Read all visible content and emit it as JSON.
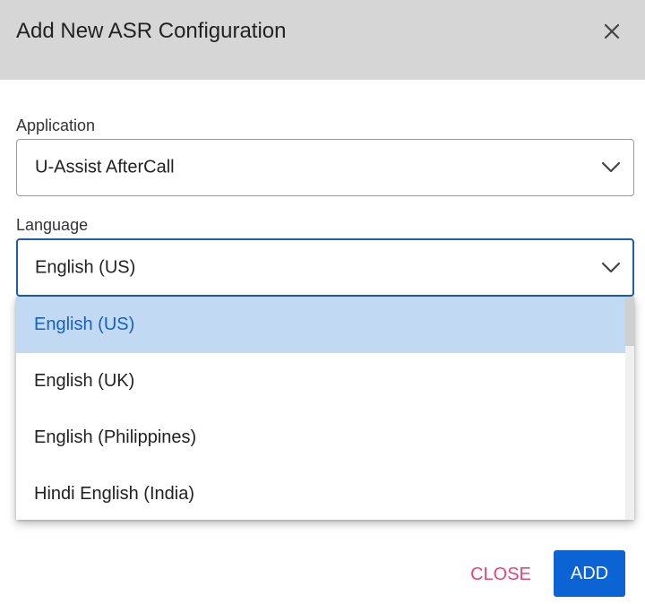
{
  "dialog": {
    "title": "Add New ASR Configuration"
  },
  "application_field": {
    "label": "Application",
    "value": "U-Assist AfterCall"
  },
  "language_field": {
    "label": "Language",
    "value": "English (US)",
    "options": [
      "English (US)",
      "English (UK)",
      "English (Philippines)",
      "Hindi English (India)"
    ],
    "selected_index": 0
  },
  "footer": {
    "close_label": "CLOSE",
    "add_label": "ADD"
  },
  "colors": {
    "header_bg": "#d6d6d6",
    "primary": "#0b63d4",
    "close_text": "#e8457a",
    "selected_option_bg": "#c2d9f3",
    "selected_option_text": "#1560c0",
    "focus_border": "#1a5fb4"
  },
  "icons": {
    "close": "close-icon",
    "dropdown": "chevron-down-icon"
  }
}
